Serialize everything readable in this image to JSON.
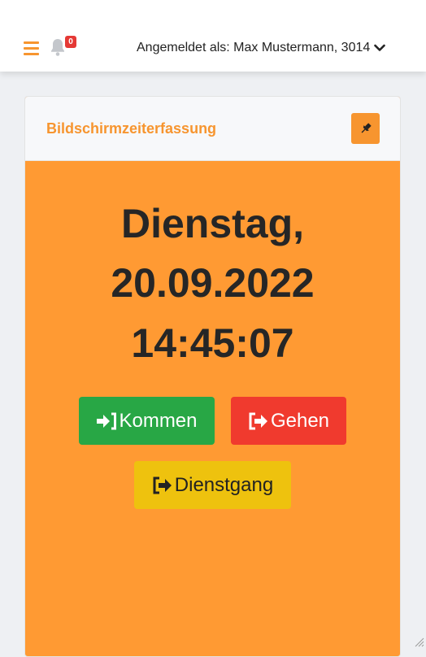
{
  "header": {
    "menu_icon": "hamburger-icon",
    "notifications": {
      "icon": "bell-icon",
      "count": "0"
    },
    "user_label": "Angemeldet als: Max Mustermann, 3014",
    "user_dropdown_icon": "chevron-down-icon"
  },
  "card": {
    "title": "Bildschirmzeiterfassung",
    "pin_icon": "thumbtack-icon",
    "weekday": "Dienstag,",
    "date": "20.09.2022",
    "time": "14:45:07",
    "buttons": {
      "kommen": "Kommen",
      "gehen": "Gehen",
      "dienstgang": "Dienstgang"
    }
  },
  "colors": {
    "accent": "#f7952f",
    "card_body": "#ff9a33",
    "kommen": "#28a745",
    "gehen": "#f03a2e",
    "dienstgang": "#eec20e",
    "badge": "#e53935"
  }
}
